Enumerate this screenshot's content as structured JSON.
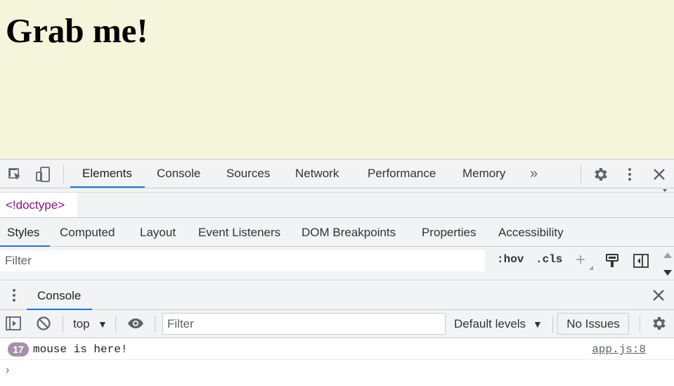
{
  "page": {
    "heading": "Grab me!",
    "background": "#f5f5dc"
  },
  "devtools": {
    "tabs": [
      {
        "label": "Elements",
        "active": true
      },
      {
        "label": "Console",
        "active": false
      },
      {
        "label": "Sources",
        "active": false
      },
      {
        "label": "Network",
        "active": false
      },
      {
        "label": "Performance",
        "active": false
      },
      {
        "label": "Memory",
        "active": false
      }
    ],
    "more_tabs": "»",
    "icons": {
      "inspect": "inspect-element-icon",
      "device": "device-toolbar-icon",
      "settings": "gear-icon",
      "menu": "kebab-menu-icon",
      "close": "close-icon"
    },
    "accent": "#1a73e8"
  },
  "elements": {
    "breadcrumb": "<!doctype>",
    "subtabs": [
      {
        "label": "Styles",
        "active": true
      },
      {
        "label": "Computed",
        "active": false
      },
      {
        "label": "Layout",
        "active": false
      },
      {
        "label": "Event Listeners",
        "active": false
      },
      {
        "label": "DOM Breakpoints",
        "active": false
      },
      {
        "label": "Properties",
        "active": false
      },
      {
        "label": "Accessibility",
        "active": false
      }
    ],
    "filter_placeholder": "Filter",
    "hov": ":hov",
    "cls": ".cls",
    "plus": "+"
  },
  "drawer": {
    "tab_label": "Console"
  },
  "console": {
    "context": "top",
    "filter_placeholder": "Filter",
    "levels": "Default levels",
    "levels_arrow": "▼",
    "context_arrow": "▼",
    "issues": "No Issues",
    "messages": [
      {
        "count": "17",
        "text": "mouse is here!",
        "source": "app.js:8"
      }
    ],
    "prompt": "›"
  }
}
